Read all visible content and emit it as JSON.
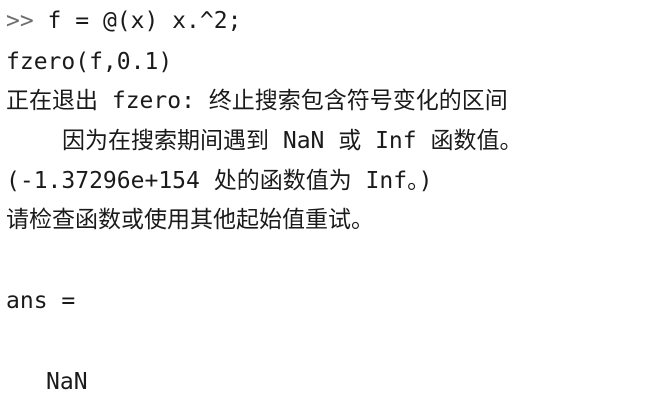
{
  "console": {
    "prompt": ">>",
    "command1": " f = @(x) x.^2;",
    "command2": "fzero(f,0.1)",
    "messages": [
      "正在退出 fzero: 终止搜索包含符号变化的区间",
      "因为在搜索期间遇到 NaN 或 Inf 函数值。",
      "(-1.37296e+154 处的函数值为 Inf。)",
      "请检查函数或使用其他起始值重试。"
    ],
    "ans_label": "ans =",
    "ans_value": "NaN"
  }
}
